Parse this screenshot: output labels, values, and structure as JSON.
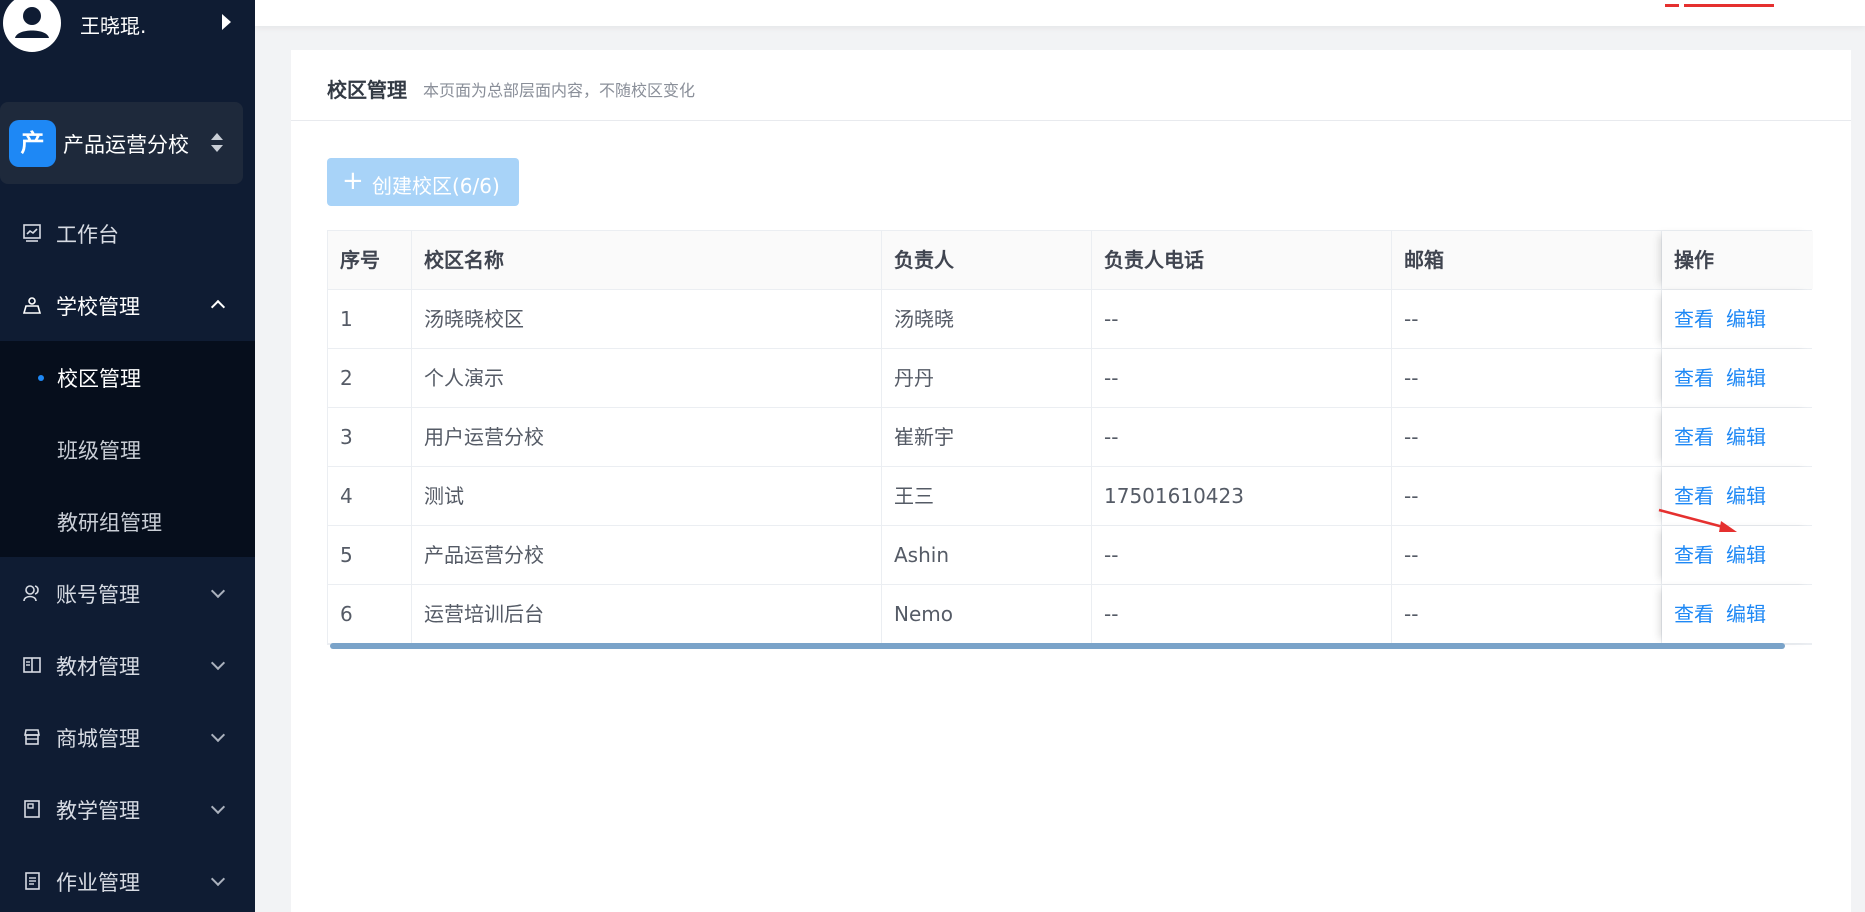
{
  "user": {
    "name": "王晓琨."
  },
  "school": {
    "badge": "产",
    "name": "产品运营分校"
  },
  "nav": {
    "workbench": "工作台",
    "school_mgmt": "学校管理",
    "sub": {
      "campus": "校区管理",
      "class": "班级管理",
      "research": "教研组管理"
    },
    "account": "账号管理",
    "textbook": "教材管理",
    "mall": "商城管理",
    "teaching": "教学管理",
    "homework": "作业管理"
  },
  "page": {
    "title": "校区管理",
    "subtitle": "本页面为总部层面内容，不随校区变化",
    "create_button": "创建校区(6/6)"
  },
  "table": {
    "headers": [
      "序号",
      "校区名称",
      "负责人",
      "负责人电话",
      "邮箱",
      "操作"
    ],
    "rows": [
      [
        "1",
        "汤晓晓校区",
        "汤晓晓",
        "--",
        "--"
      ],
      [
        "2",
        "个人演示",
        "丹丹",
        "--",
        "--"
      ],
      [
        "3",
        "用户运营分校",
        "崔新宇",
        "--",
        "--"
      ],
      [
        "4",
        "测试",
        "王三",
        "17501610423",
        "--"
      ],
      [
        "5",
        "产品运营分校",
        "Ashin",
        "--",
        "--"
      ],
      [
        "6",
        "运营培训后台",
        "Nemo",
        "--",
        "--"
      ]
    ],
    "actions": {
      "view": "查看",
      "edit": "编辑"
    }
  },
  "colors": {
    "sidebar": "#0f1c33",
    "primary": "#1e88f5",
    "annotation": "#e5302f"
  }
}
